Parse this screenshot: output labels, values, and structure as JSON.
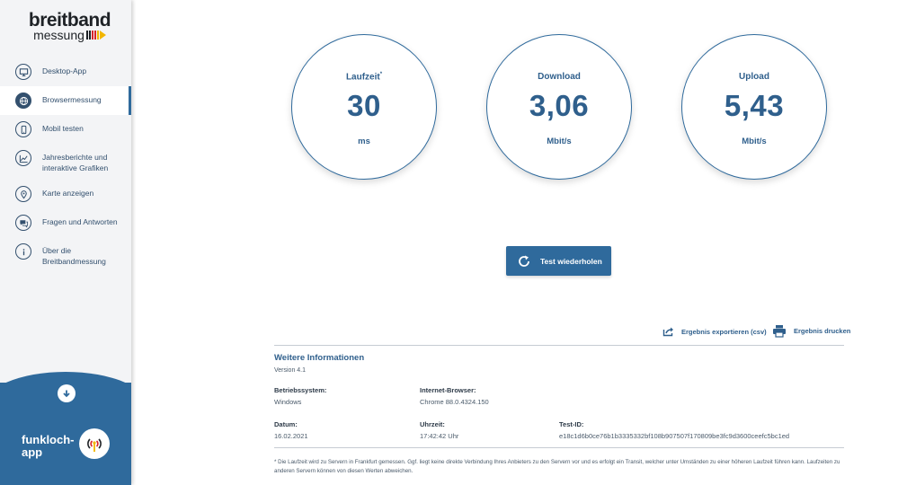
{
  "logo": {
    "line1": "breitband",
    "line2": "messung"
  },
  "brand_colors": {
    "accent": "#2f6a9c",
    "flag_black": "#1e2226",
    "flag_red": "#d8232a",
    "flag_gold": "#f2b600"
  },
  "sidebar": {
    "items": [
      {
        "label": "Desktop-App",
        "icon": "monitor-icon",
        "active": false
      },
      {
        "label": "Browsermessung",
        "icon": "globe-icon",
        "active": true
      },
      {
        "label": "Mobil testen",
        "icon": "smartphone-icon",
        "active": false
      },
      {
        "label": "Jahresberichte und interaktive Grafiken",
        "icon": "chart-icon",
        "active": false
      },
      {
        "label": "Karte anzeigen",
        "icon": "map-pin-icon",
        "active": false
      },
      {
        "label": "Fragen und Antworten",
        "icon": "chat-icon",
        "active": false
      },
      {
        "label": "Über die Breitbandmessung",
        "icon": "info-icon",
        "active": false
      }
    ],
    "funkloch": "funkloch-app"
  },
  "results": {
    "latency": {
      "label": "Laufzeit",
      "marker": "*",
      "value": "30",
      "unit": "ms"
    },
    "download": {
      "label": "Download",
      "value": "3,06",
      "unit": "Mbit/s"
    },
    "upload": {
      "label": "Upload",
      "value": "5,43",
      "unit": "Mbit/s"
    }
  },
  "retest_label": "Test wiederholen",
  "actions": {
    "export": "Ergebnis exportieren (csv)",
    "print": "Ergebnis drucken"
  },
  "info": {
    "title": "Weitere Informationen",
    "version": "Version 4.1",
    "os_label": "Betriebssystem:",
    "os_value": "Windows",
    "browser_label": "Internet-Browser:",
    "browser_value": "Chrome 88.0.4324.150",
    "date_label": "Datum:",
    "date_value": "16.02.2021",
    "time_label": "Uhrzeit:",
    "time_value": "17:42:42 Uhr",
    "testid_label": "Test-ID:",
    "testid_value": "e18c1d6b0ce76b1b3335332bf108b907507f170809be3fc9d3600ceefc5bc1ed"
  },
  "footnote": "* Die Laufzeit wird zu Servern in Frankfurt gemessen. Ggf. liegt keine direkte Verbindung Ihres Anbieters zu den Servern vor und es erfolgt ein Transit, welcher unter Umständen zu einer höheren Laufzeit führen kann. Laufzeiten zu anderen Servern können von diesen Werten abweichen."
}
